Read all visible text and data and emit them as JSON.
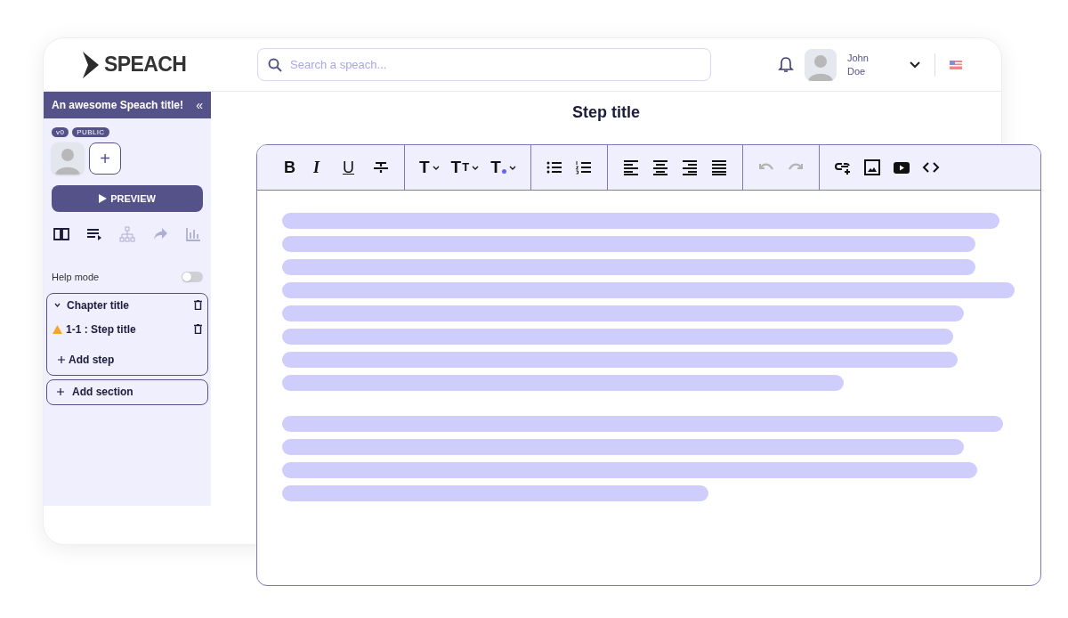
{
  "header": {
    "logo": "SPEACH",
    "search": {
      "placeholder": "Search a speach..."
    },
    "user": {
      "first_name": "John",
      "last_name": "Doe"
    }
  },
  "sidebar": {
    "title": "An awesome Speach title!",
    "collapse": "«",
    "badges": [
      "v0",
      "PUBLIC"
    ],
    "add_author": "+",
    "preview": "PREVIEW",
    "nav_icons": [
      {
        "kind": "book",
        "disabled": false
      },
      {
        "kind": "playlist",
        "disabled": false
      },
      {
        "kind": "tree",
        "disabled": true
      },
      {
        "kind": "share",
        "disabled": true
      },
      {
        "kind": "stats",
        "disabled": true
      }
    ],
    "help_mode": {
      "label": "Help mode",
      "on": false
    },
    "chapters": [
      {
        "title": "Chapter title",
        "expanded": true,
        "children": [
          {
            "title": "1-1 : Step title",
            "warning": true
          }
        ],
        "add_step": "Add step"
      }
    ],
    "add_section": "Add section"
  },
  "main": {
    "step_title": "Step title"
  },
  "editor": {
    "toolbar": [
      [
        {
          "kind": "bold",
          "label": "B"
        },
        {
          "kind": "italic",
          "label": "I"
        },
        {
          "kind": "underline",
          "label": "U"
        },
        {
          "kind": "strike"
        }
      ],
      [
        {
          "kind": "heading",
          "label": "T"
        },
        {
          "kind": "size",
          "label": "T",
          "small_label": "T"
        },
        {
          "kind": "color",
          "label": "T"
        }
      ],
      [
        {
          "kind": "bullets"
        },
        {
          "kind": "numbers"
        }
      ],
      [
        {
          "kind": "align-left"
        },
        {
          "kind": "align-center"
        },
        {
          "kind": "align-right"
        },
        {
          "kind": "justify"
        }
      ],
      [
        {
          "kind": "undo",
          "disabled": true
        },
        {
          "kind": "redo",
          "disabled": true
        }
      ],
      [
        {
          "kind": "link"
        },
        {
          "kind": "image"
        },
        {
          "kind": "video"
        },
        {
          "kind": "code"
        }
      ]
    ]
  }
}
